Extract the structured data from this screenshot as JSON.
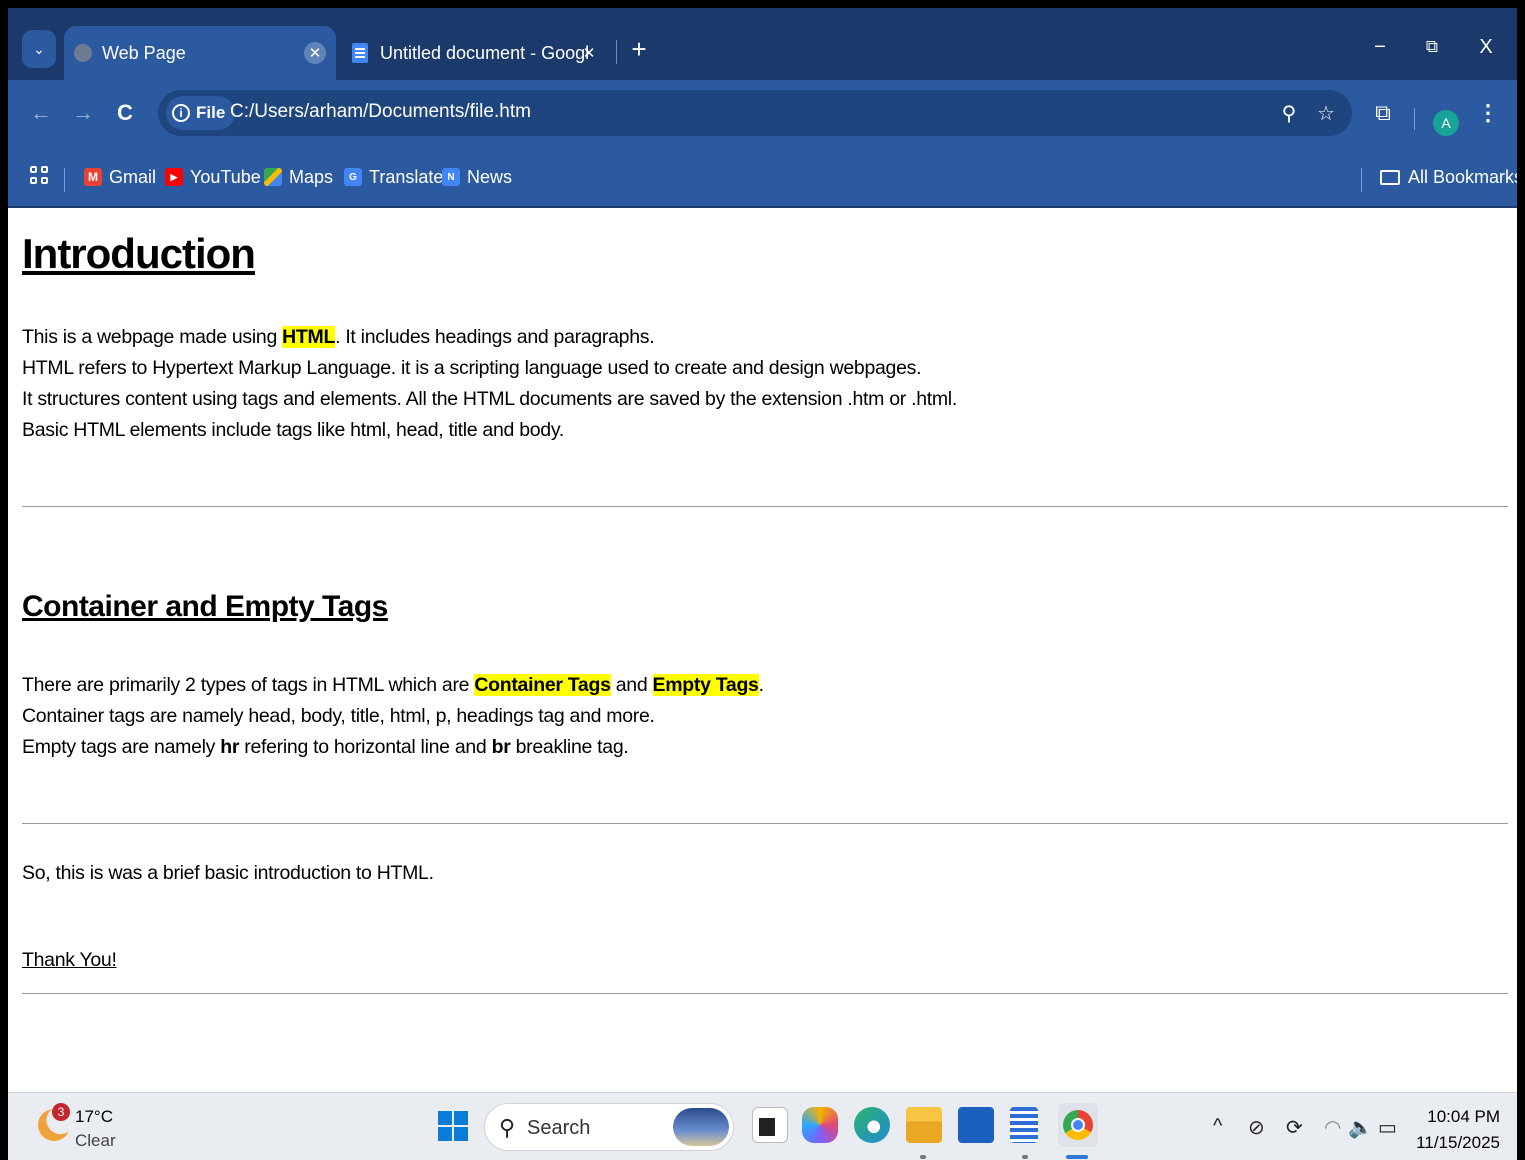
{
  "browser": {
    "tabs": [
      {
        "label": "Web Page",
        "active": true
      },
      {
        "label": "Untitled document - Google Do",
        "active": false
      }
    ],
    "new_tab": "+",
    "window_controls": {
      "minimize": "−",
      "restore": "⧉",
      "close": "X"
    },
    "nav": {
      "back": "←",
      "forward": "→",
      "reload": "C"
    },
    "site_chip": "File",
    "url": "C:/Users/arham/Documents/file.htm",
    "profile_initial": "A",
    "bookmarks": [
      {
        "label": "Gmail",
        "icon": "gmail-icon",
        "color": "#ea4335"
      },
      {
        "label": "YouTube",
        "icon": "youtube-icon",
        "color": "#ff0000"
      },
      {
        "label": "Maps",
        "icon": "maps-icon",
        "color": "#34a853"
      },
      {
        "label": "Translate",
        "icon": "translate-icon",
        "color": "#4285f4"
      },
      {
        "label": "News",
        "icon": "news-icon",
        "color": "#4285f4"
      }
    ],
    "all_bookmarks": "All Bookmarks",
    "colors": {
      "titlebar": "#1b3a6b",
      "toolbar": "#2b5aa1",
      "highlight": "#ffff00"
    }
  },
  "page": {
    "heading1": "Introduction",
    "intro": {
      "line1_before": "This is a webpage made using ",
      "line1_highlight": "HTML",
      "line1_after": ". It includes headings and paragraphs.",
      "line2": "HTML refers to Hypertext Markup Language. it is a scripting language used to create and design webpages.",
      "line3": "It structures content using tags and elements. All the HTML documents are saved by the extension .htm or .html.",
      "line4": "Basic HTML elements include tags like html, head, title and body."
    },
    "heading2": "Container and Empty Tags",
    "tags": {
      "line1_before": "There are primarily 2 types of tags in HTML which are ",
      "line1_hl1": "Container Tags",
      "line1_mid": " and ",
      "line1_hl2": "Empty Tags",
      "line1_after": ".",
      "line2": "Container tags are namely head, body, title, html, p, headings tag and more.",
      "line3_a": "Empty tags are namely ",
      "line3_b": "hr",
      "line3_c": " refering to horizontal line and ",
      "line3_d": "br",
      "line3_e": " breakline tag."
    },
    "closing": "So, this is was a brief basic introduction to HTML.",
    "thanks": "Thank You!"
  },
  "taskbar": {
    "weather_badge": "3",
    "temperature": "17°C",
    "condition": "Clear",
    "search_label": "Search",
    "time": "10:04 PM",
    "date": "11/15/2025"
  }
}
